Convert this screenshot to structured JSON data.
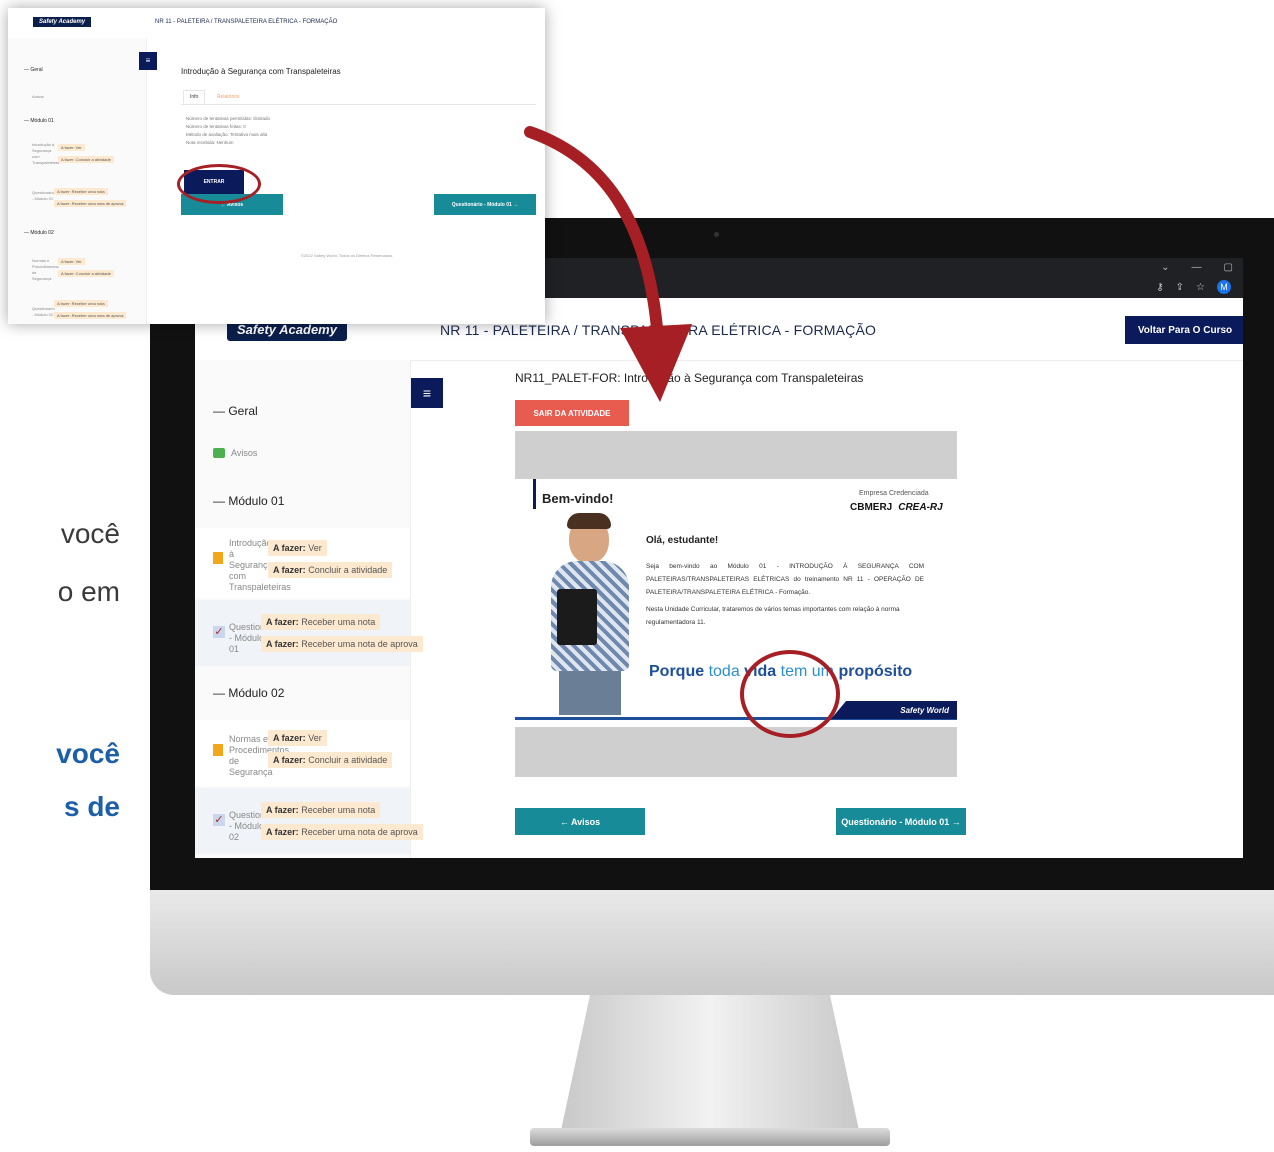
{
  "left_text": {
    "line1": "você",
    "line2": "o em",
    "line3": "você",
    "line4": "s de"
  },
  "colors": {
    "brand_dark": "#0b1a5a",
    "teal": "#178b98",
    "red_button": "#e85b4f",
    "todo_tag": "#fde9cf",
    "highlight_circle": "#a51f24"
  },
  "main": {
    "logo": "Safety Academy",
    "course_title": "NR 11 - PALETEIRA / TRANSPALETEIRA ELÉTRICA - FORMAÇÃO",
    "back_button": "Voltar Para O Curso",
    "page_title": "NR11_PALET-FOR: Introdução à Segurança com Transpaleteiras",
    "exit_button": "SAIR DA ATIVIDADE",
    "sidebar": {
      "geral": "— Geral",
      "avisos": "Avisos",
      "modulo01": "— Módulo 01",
      "modulo02": "— Módulo 02",
      "item1_name": "Introdução à Segurança com Transpaleteiras",
      "item1_tag1_label": "A fazer:",
      "item1_tag1_value": "Ver",
      "item1_tag2_label": "A fazer:",
      "item1_tag2_value": "Concluir a atividade",
      "item2_name": "Questionário - Módulo 01",
      "item2_tag1_label": "A fazer:",
      "item2_tag1_value": "Receber uma nota",
      "item2_tag2_label": "A fazer:",
      "item2_tag2_value": "Receber uma nota de aprova",
      "item3_name": "Normas e Procedimentos de Segurança",
      "item3_tag1_label": "A fazer:",
      "item3_tag1_value": "Ver",
      "item3_tag2_label": "A fazer:",
      "item3_tag2_value": "Concluir a atividade",
      "item4_name": "Questionário - Módulo 02",
      "item4_tag1_label": "A fazer:",
      "item4_tag1_value": "Receber uma nota",
      "item4_tag2_label": "A fazer:",
      "item4_tag2_value": "Receber uma nota de aprova"
    },
    "content": {
      "welcome": "Bem-vindo!",
      "credential_label": "Empresa Credenciada",
      "credential_orgs": "CBMERJ",
      "credential_orgs2": "CREA-RJ",
      "greeting": "Olá, estudante!",
      "paragraph1": "Seja bem-vindo ao Módulo 01 - INTRODUÇÃO À SEGURANÇA COM PALETEIRAS/TRANSPALETEIRAS ELÉTRICAS do treinamento NR 11 - OPERAÇÃO DE PALETEIRA/TRANSPALETEIRA ELÉTRICA - Formação.",
      "paragraph2": "Nesta Unidade Curricular, trataremos de vários temas importantes com relação à norma regulamentadora 11.",
      "slogan_a": "Porque",
      "slogan_b": "toda",
      "slogan_c": "vida",
      "slogan_d": "tem um",
      "slogan_e": "propósito",
      "footer_brand": "Safety World"
    },
    "nav": {
      "prev": "← Avisos",
      "next": "Questionário - Módulo 01 →"
    }
  },
  "callout": {
    "logo": "Safety Academy",
    "course_title": "NR 11 - PALETEIRA / TRANSPALETEIRA ELÉTRICA - FORMAÇÃO",
    "activity_title": "Introdução à Segurança com Transpaleteiras",
    "tab_info": "Info",
    "tab_attempts": "Relatórios",
    "line1": "Número de tentativas permitidas: Ilimitado",
    "line2": "Número de tentativas feitas: 0",
    "line3": "Método de avaliação: Tentativa mais alta",
    "line4": "Nota recebida: Nenhum",
    "enter_button": "ENTRAR",
    "prev_button": "← Avisos",
    "next_button": "Questionário - Módulo 01 →",
    "footer1": "©2022 Safety World. Todos os Direitos Reservados.",
    "sidebar_geral": "— Geral",
    "sidebar_avisos": "Avisos",
    "sidebar_mod1": "— Módulo 01",
    "sidebar_mod2": "— Módulo 02",
    "s_item1": "Introdução à Segurança com Transpaleteiras",
    "s_item2": "Questionário - Módulo 01",
    "s_item3": "Normas e Procedimentos de Segurança",
    "s_item4": "Questionário - Módulo 02",
    "tag_ver": "A fazer: Ver",
    "tag_concluir": "A fazer: Concluir a atividade",
    "tag_nota": "A fazer: Receber uma nota",
    "tag_aprov": "A fazer: Receber uma nota de aprova"
  }
}
